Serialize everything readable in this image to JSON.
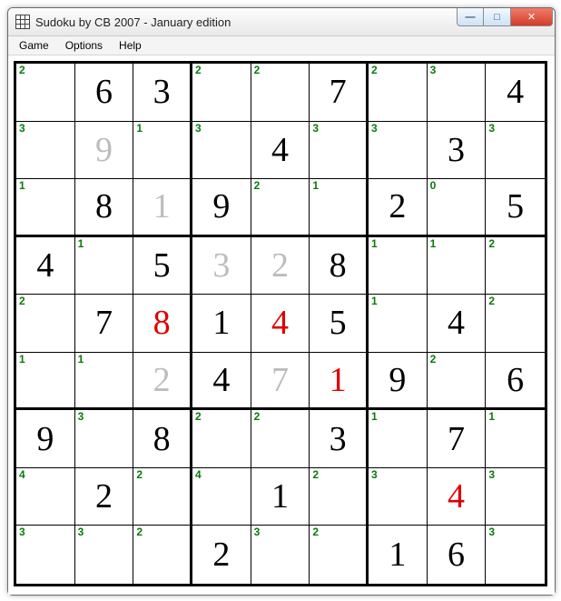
{
  "window": {
    "title": "Sudoku by CB 2007 - January edition"
  },
  "menu": {
    "items": [
      "Game",
      "Options",
      "Help"
    ]
  },
  "win_buttons": {
    "min": "—",
    "max": "□",
    "close": "✕"
  },
  "sudoku": {
    "cells": [
      [
        {
          "hint": "2",
          "value": "",
          "color": "black"
        },
        {
          "hint": "",
          "value": "6",
          "color": "black"
        },
        {
          "hint": "",
          "value": "3",
          "color": "black"
        },
        {
          "hint": "2",
          "value": "",
          "color": "black"
        },
        {
          "hint": "2",
          "value": "",
          "color": "black"
        },
        {
          "hint": "",
          "value": "7",
          "color": "black"
        },
        {
          "hint": "2",
          "value": "",
          "color": "black"
        },
        {
          "hint": "3",
          "value": "",
          "color": "black"
        },
        {
          "hint": "",
          "value": "4",
          "color": "black"
        }
      ],
      [
        {
          "hint": "3",
          "value": "",
          "color": "black"
        },
        {
          "hint": "",
          "value": "9",
          "color": "grey"
        },
        {
          "hint": "1",
          "value": "",
          "color": "black"
        },
        {
          "hint": "3",
          "value": "",
          "color": "black"
        },
        {
          "hint": "",
          "value": "4",
          "color": "black"
        },
        {
          "hint": "3",
          "value": "",
          "color": "black"
        },
        {
          "hint": "3",
          "value": "",
          "color": "black"
        },
        {
          "hint": "",
          "value": "3",
          "color": "black"
        },
        {
          "hint": "3",
          "value": "",
          "color": "black"
        }
      ],
      [
        {
          "hint": "1",
          "value": "",
          "color": "black"
        },
        {
          "hint": "",
          "value": "8",
          "color": "black"
        },
        {
          "hint": "",
          "value": "1",
          "color": "grey"
        },
        {
          "hint": "",
          "value": "9",
          "color": "black"
        },
        {
          "hint": "2",
          "value": "",
          "color": "black"
        },
        {
          "hint": "1",
          "value": "",
          "color": "black"
        },
        {
          "hint": "",
          "value": "2",
          "color": "black"
        },
        {
          "hint": "0",
          "value": "",
          "color": "black"
        },
        {
          "hint": "",
          "value": "5",
          "color": "black"
        }
      ],
      [
        {
          "hint": "",
          "value": "4",
          "color": "black"
        },
        {
          "hint": "1",
          "value": "",
          "color": "black"
        },
        {
          "hint": "",
          "value": "5",
          "color": "black"
        },
        {
          "hint": "",
          "value": "3",
          "color": "grey"
        },
        {
          "hint": "",
          "value": "2",
          "color": "grey"
        },
        {
          "hint": "",
          "value": "8",
          "color": "black"
        },
        {
          "hint": "1",
          "value": "",
          "color": "black"
        },
        {
          "hint": "1",
          "value": "",
          "color": "black"
        },
        {
          "hint": "2",
          "value": "",
          "color": "black"
        }
      ],
      [
        {
          "hint": "2",
          "value": "",
          "color": "black"
        },
        {
          "hint": "",
          "value": "7",
          "color": "black"
        },
        {
          "hint": "",
          "value": "8",
          "color": "red"
        },
        {
          "hint": "",
          "value": "1",
          "color": "black"
        },
        {
          "hint": "",
          "value": "4",
          "color": "red"
        },
        {
          "hint": "",
          "value": "5",
          "color": "black"
        },
        {
          "hint": "1",
          "value": "",
          "color": "black"
        },
        {
          "hint": "",
          "value": "4",
          "color": "black"
        },
        {
          "hint": "2",
          "value": "",
          "color": "black"
        }
      ],
      [
        {
          "hint": "1",
          "value": "",
          "color": "black"
        },
        {
          "hint": "1",
          "value": "",
          "color": "black"
        },
        {
          "hint": "",
          "value": "2",
          "color": "grey"
        },
        {
          "hint": "",
          "value": "4",
          "color": "black"
        },
        {
          "hint": "",
          "value": "7",
          "color": "grey"
        },
        {
          "hint": "",
          "value": "1",
          "color": "red"
        },
        {
          "hint": "",
          "value": "9",
          "color": "black"
        },
        {
          "hint": "2",
          "value": "",
          "color": "black"
        },
        {
          "hint": "",
          "value": "6",
          "color": "black"
        }
      ],
      [
        {
          "hint": "",
          "value": "9",
          "color": "black"
        },
        {
          "hint": "3",
          "value": "",
          "color": "black"
        },
        {
          "hint": "",
          "value": "8",
          "color": "black"
        },
        {
          "hint": "2",
          "value": "",
          "color": "black"
        },
        {
          "hint": "2",
          "value": "",
          "color": "black"
        },
        {
          "hint": "",
          "value": "3",
          "color": "black"
        },
        {
          "hint": "1",
          "value": "",
          "color": "black"
        },
        {
          "hint": "",
          "value": "7",
          "color": "black"
        },
        {
          "hint": "1",
          "value": "",
          "color": "black"
        }
      ],
      [
        {
          "hint": "4",
          "value": "",
          "color": "black"
        },
        {
          "hint": "",
          "value": "2",
          "color": "black"
        },
        {
          "hint": "2",
          "value": "",
          "color": "black"
        },
        {
          "hint": "4",
          "value": "",
          "color": "black"
        },
        {
          "hint": "",
          "value": "1",
          "color": "black"
        },
        {
          "hint": "2",
          "value": "",
          "color": "black"
        },
        {
          "hint": "3",
          "value": "",
          "color": "black"
        },
        {
          "hint": "",
          "value": "4",
          "color": "red"
        },
        {
          "hint": "3",
          "value": "",
          "color": "black"
        }
      ],
      [
        {
          "hint": "3",
          "value": "",
          "color": "black"
        },
        {
          "hint": "3",
          "value": "",
          "color": "black"
        },
        {
          "hint": "2",
          "value": "",
          "color": "black"
        },
        {
          "hint": "",
          "value": "2",
          "color": "black"
        },
        {
          "hint": "3",
          "value": "",
          "color": "black"
        },
        {
          "hint": "2",
          "value": "",
          "color": "black"
        },
        {
          "hint": "",
          "value": "1",
          "color": "black"
        },
        {
          "hint": "",
          "value": "6",
          "color": "black"
        },
        {
          "hint": "3",
          "value": "",
          "color": "black"
        }
      ]
    ]
  }
}
